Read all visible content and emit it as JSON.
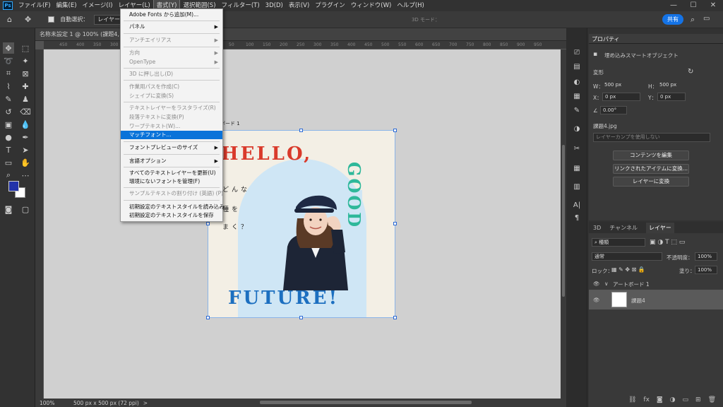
{
  "menubar": {
    "items": [
      "ファイル(F)",
      "編集(E)",
      "イメージ(I)",
      "レイヤー(L)",
      "書式(Y)",
      "選択範囲(S)",
      "フィルター(T)",
      "3D(D)",
      "表示(V)",
      "プラグイン",
      "ウィンドウ(W)",
      "ヘルプ(H)"
    ],
    "logo": "Ps"
  },
  "options": {
    "auto_select": "自動選択：",
    "layer": "レイヤー",
    "threed_mode": "3D モード：",
    "share": "共有"
  },
  "document": {
    "tab_title": "名称未設定 1 @ 100% (課題4, R",
    "zoom": "100%",
    "doc_info": "500 px x 500 px (72 ppi)"
  },
  "ruler": {
    "ticks": [
      "450",
      "400",
      "350",
      "300",
      "250",
      "200",
      "150",
      "100",
      "50",
      "0",
      "50",
      "100",
      "150",
      "200",
      "250",
      "300",
      "350",
      "400",
      "450",
      "500",
      "550",
      "600",
      "650",
      "700",
      "750",
      "800",
      "850",
      "900",
      "950"
    ]
  },
  "artboard": {
    "label": "ボード 1",
    "hello": "HELLO,",
    "good": "GOOD",
    "future": "FUTURE!",
    "jp_lines": [
      "どんな",
      "種を",
      "まく？"
    ]
  },
  "type_menu": {
    "items": [
      {
        "label": "Adobe Fonts から追加(M)...",
        "state": "normal",
        "arrow": ""
      },
      {
        "label": "パネル",
        "state": "normal",
        "arrow": "▶"
      },
      {
        "label": "アンチエイリアス",
        "state": "disabled",
        "arrow": "▶"
      },
      {
        "label": "方向",
        "state": "disabled",
        "arrow": "▶"
      },
      {
        "label": "OpenType",
        "state": "disabled",
        "arrow": "▶"
      },
      {
        "label": "3D に押し出し(D)",
        "state": "disabled",
        "arrow": ""
      },
      {
        "label": "作業用パスを作成(C)",
        "state": "disabled",
        "arrow": ""
      },
      {
        "label": "シェイプに変換(S)",
        "state": "disabled",
        "arrow": ""
      },
      {
        "label": "テキストレイヤーをラスタライズ(R)",
        "state": "disabled",
        "arrow": ""
      },
      {
        "label": "段落テキストに変換(P)",
        "state": "disabled",
        "arrow": ""
      },
      {
        "label": "ワープテキスト(W)...",
        "state": "disabled",
        "arrow": ""
      },
      {
        "label": "マッチフォント...",
        "state": "selected",
        "arrow": ""
      },
      {
        "label": "フォントプレビューのサイズ",
        "state": "normal",
        "arrow": "▶"
      },
      {
        "label": "言語オプション",
        "state": "normal",
        "arrow": "▶"
      },
      {
        "label": "すべてのテキストレイヤーを更新(U)",
        "state": "normal",
        "arrow": ""
      },
      {
        "label": "環境にないフォントを管理(F)",
        "state": "normal",
        "arrow": ""
      },
      {
        "label": "サンプルテキストの割り付け (英語) (P)",
        "state": "disabled",
        "arrow": ""
      },
      {
        "label": "初期設定のテキストスタイルを読み込み",
        "state": "normal",
        "arrow": ""
      },
      {
        "label": "初期設定のテキストスタイルを保存",
        "state": "normal",
        "arrow": ""
      }
    ]
  },
  "properties": {
    "title": "プロパティ",
    "object_type": "埋め込みスマートオブジェクト",
    "section": "変形",
    "w_label": "W：",
    "w": "500 px",
    "h_label": "H：",
    "h": "500 px",
    "x_label": "X：",
    "x": "0 px",
    "y_label": "Y：",
    "y": "0 px",
    "angle": "0.00°",
    "source_file": "課題4.jpg",
    "layer_comp": "レイヤーカンプを使用しない",
    "btn_edit": "コンテンツを編集",
    "btn_convert_linked": "リンクされたアイテムに変換...",
    "btn_to_layers": "レイヤーに変換"
  },
  "layers_panel": {
    "tabs": [
      "3D",
      "チャンネル",
      "レイヤー"
    ],
    "kind": "種類",
    "blend": "通常",
    "opacity_label": "不透明度：",
    "opacity": "100%",
    "lock_label": "ロック：",
    "fill_label": "塗り：",
    "fill": "100%",
    "artboard_name": "アートボード 1",
    "layer_name": "課題4"
  },
  "colors": {
    "hello": "#d93a2b",
    "good": "#2eb89a",
    "future": "#1c6fc0",
    "foreground": "#2233aa",
    "menu_selected": "#0a73d9",
    "share": "#1473e6"
  }
}
